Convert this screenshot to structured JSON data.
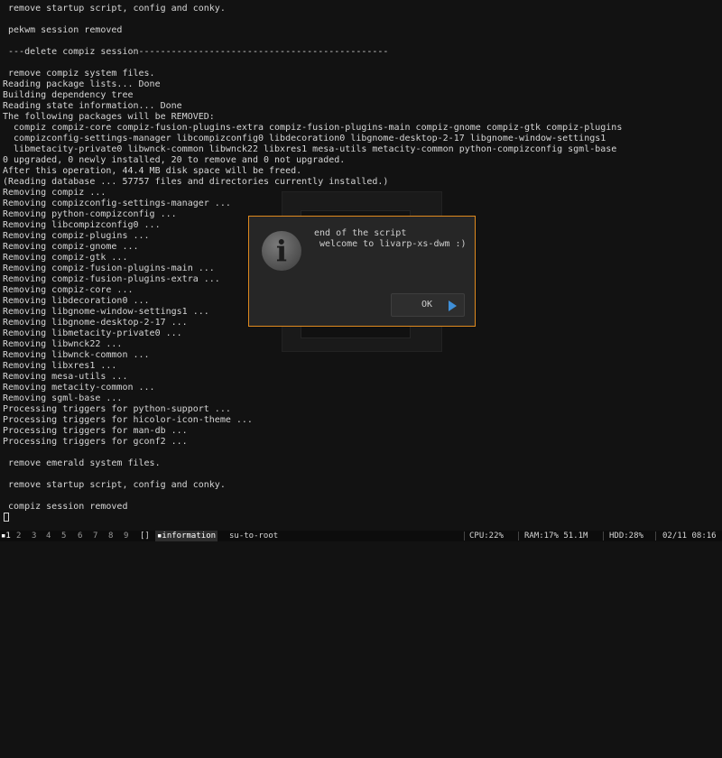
{
  "terminal": {
    "lines": [
      " remove startup script, config and conky.",
      "",
      " pekwm session removed",
      "",
      " ---delete compiz session----------------------------------------------",
      "",
      " remove compiz system files.",
      "Reading package lists... Done",
      "Building dependency tree",
      "Reading state information... Done",
      "The following packages will be REMOVED:",
      "  compiz compiz-core compiz-fusion-plugins-extra compiz-fusion-plugins-main compiz-gnome compiz-gtk compiz-plugins",
      "  compizconfig-settings-manager libcompizconfig0 libdecoration0 libgnome-desktop-2-17 libgnome-window-settings1",
      "  libmetacity-private0 libwnck-common libwnck22 libxres1 mesa-utils metacity-common python-compizconfig sgml-base",
      "0 upgraded, 0 newly installed, 20 to remove and 0 not upgraded.",
      "After this operation, 44.4 MB disk space will be freed.",
      "(Reading database ... 57757 files and directories currently installed.)",
      "Removing compiz ...",
      "Removing compizconfig-settings-manager ...",
      "Removing python-compizconfig ...",
      "Removing libcompizconfig0 ...",
      "Removing compiz-plugins ...",
      "Removing compiz-gnome ...",
      "Removing compiz-gtk ...",
      "Removing compiz-fusion-plugins-main ...",
      "Removing compiz-fusion-plugins-extra ...",
      "Removing compiz-core ...",
      "Removing libdecoration0 ...",
      "Removing libgnome-window-settings1 ...",
      "Removing libgnome-desktop-2-17 ...",
      "Removing libmetacity-private0 ...",
      "Removing libwnck22 ...",
      "Removing libwnck-common ...",
      "Removing libxres1 ...",
      "Removing mesa-utils ...",
      "Removing metacity-common ...",
      "Removing sgml-base ...",
      "Processing triggers for python-support ...",
      "Processing triggers for hicolor-icon-theme ...",
      "Processing triggers for man-db ...",
      "Processing triggers for gconf2 ...",
      "",
      " remove emerald system files.",
      "",
      " remove startup script, config and conky.",
      "",
      " compiz session removed"
    ]
  },
  "dialog": {
    "message_line1": "end of the script",
    "message_line2": " welcome to livarp-xs-dwm :)",
    "ok_label": "OK",
    "icon": "info-icon",
    "border_color": "#e08a1e",
    "ok_arrow_color": "#3f8fd8"
  },
  "statusbar": {
    "tags": [
      "1",
      "2",
      "3",
      "4",
      "5",
      "6",
      "7",
      "8",
      "9"
    ],
    "active_tag": "1",
    "layout_symbol": "[]",
    "active_window": "information",
    "other_window": "su-to-root",
    "cpu": "CPU:22%",
    "ram": "RAM:17% 51.1M",
    "hdd": "HDD:28%",
    "datetime": "02/11 08:16"
  }
}
